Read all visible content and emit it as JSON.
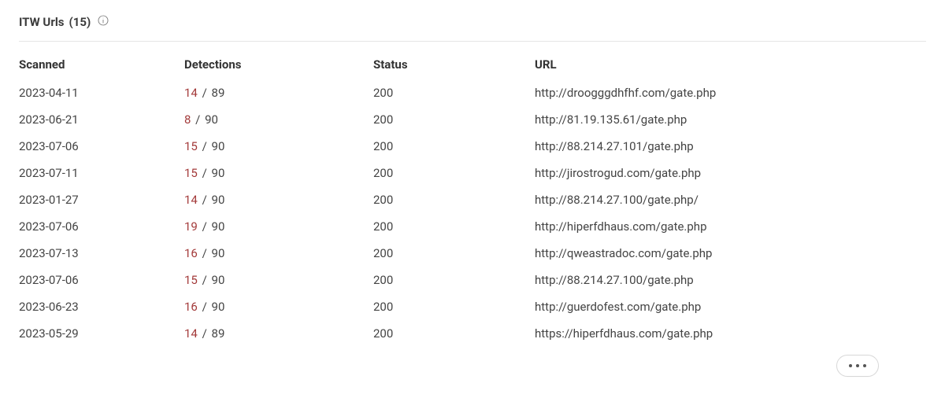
{
  "section": {
    "title": "ITW Urls",
    "count_display": "(15)"
  },
  "columns": {
    "scanned": "Scanned",
    "detections": "Detections",
    "status": "Status",
    "url": "URL"
  },
  "rows": [
    {
      "scanned": "2023-04-11",
      "hits": "14",
      "total": "89",
      "status": "200",
      "url": "http://droogggdhfhf.com/gate.php"
    },
    {
      "scanned": "2023-06-21",
      "hits": "8",
      "total": "90",
      "status": "200",
      "url": "http://81.19.135.61/gate.php"
    },
    {
      "scanned": "2023-07-06",
      "hits": "15",
      "total": "90",
      "status": "200",
      "url": "http://88.214.27.101/gate.php"
    },
    {
      "scanned": "2023-07-11",
      "hits": "15",
      "total": "90",
      "status": "200",
      "url": "http://jirostrogud.com/gate.php"
    },
    {
      "scanned": "2023-01-27",
      "hits": "14",
      "total": "90",
      "status": "200",
      "url": "http://88.214.27.100/gate.php/"
    },
    {
      "scanned": "2023-07-06",
      "hits": "19",
      "total": "90",
      "status": "200",
      "url": "http://hiperfdhaus.com/gate.php"
    },
    {
      "scanned": "2023-07-13",
      "hits": "16",
      "total": "90",
      "status": "200",
      "url": "http://qweastradoc.com/gate.php"
    },
    {
      "scanned": "2023-07-06",
      "hits": "15",
      "total": "90",
      "status": "200",
      "url": "http://88.214.27.100/gate.php"
    },
    {
      "scanned": "2023-06-23",
      "hits": "16",
      "total": "90",
      "status": "200",
      "url": "http://guerdofest.com/gate.php"
    },
    {
      "scanned": "2023-05-29",
      "hits": "14",
      "total": "89",
      "status": "200",
      "url": "https://hiperfdhaus.com/gate.php"
    }
  ],
  "detections_separator": "/"
}
